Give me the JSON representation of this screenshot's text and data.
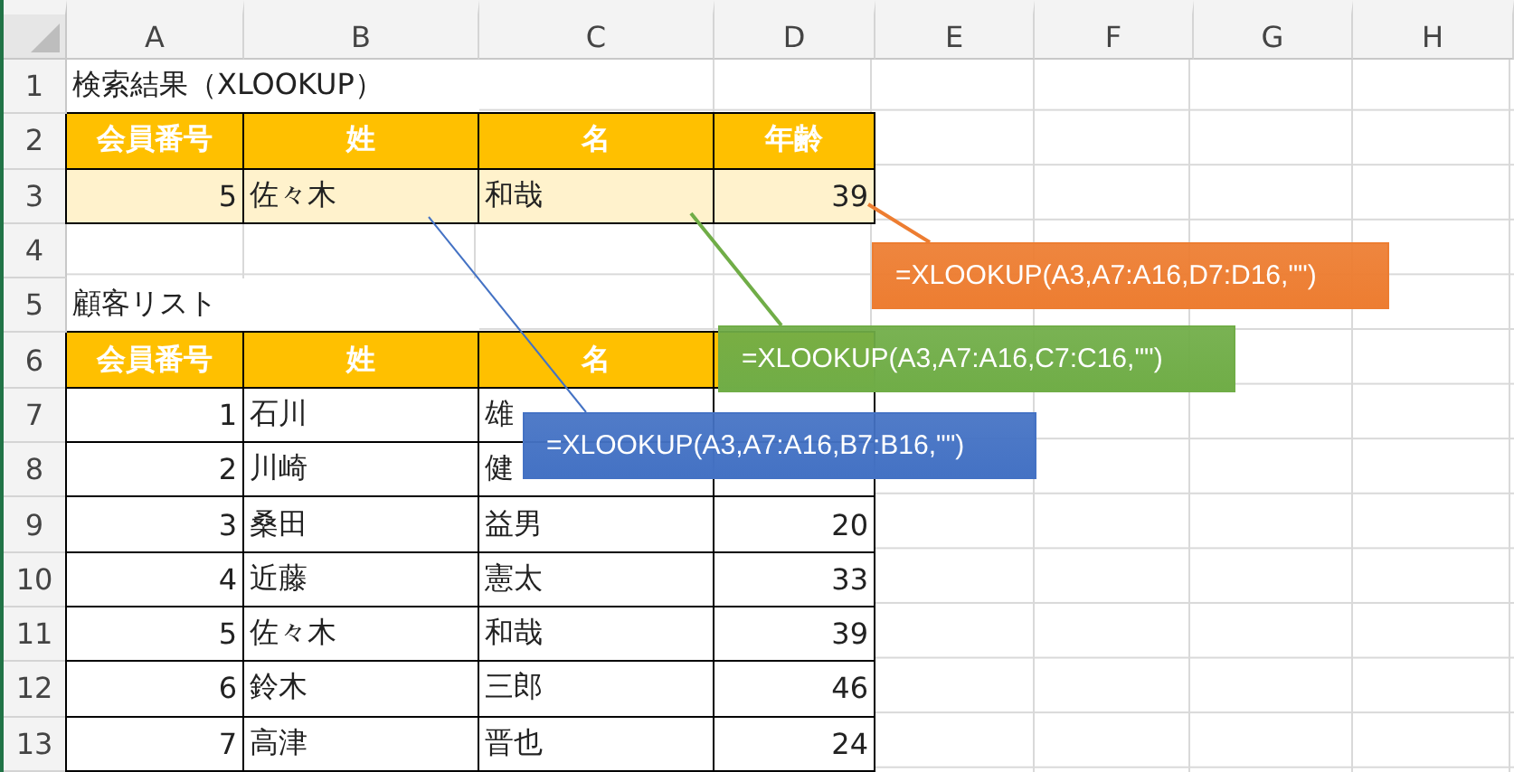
{
  "columns": [
    "A",
    "B",
    "C",
    "D",
    "E",
    "F",
    "G",
    "H"
  ],
  "rows": [
    {
      "number": "1",
      "cells": [
        {
          "text": "検索結果（XLOOKUP）",
          "kind": "label"
        }
      ]
    },
    {
      "number": "2",
      "cells": [
        {
          "text": "会員番号",
          "kind": "header"
        },
        {
          "text": "姓",
          "kind": "header"
        },
        {
          "text": "名",
          "kind": "header"
        },
        {
          "text": "年齢",
          "kind": "header"
        }
      ]
    },
    {
      "number": "3",
      "cells": [
        {
          "text": "5",
          "kind": "result"
        },
        {
          "text": "佐々木",
          "kind": "result"
        },
        {
          "text": "和哉",
          "kind": "result"
        },
        {
          "text": "39",
          "kind": "result"
        }
      ]
    },
    {
      "number": "4",
      "cells": []
    },
    {
      "number": "5",
      "cells": [
        {
          "text": "顧客リスト",
          "kind": "label"
        }
      ]
    },
    {
      "number": "6",
      "cells": [
        {
          "text": "会員番号",
          "kind": "header"
        },
        {
          "text": "姓",
          "kind": "header"
        },
        {
          "text": "名",
          "kind": "header"
        },
        {
          "kind": "header"
        }
      ]
    },
    {
      "number": "7",
      "cells": [
        {
          "text": "1",
          "kind": "data"
        },
        {
          "text": "石川",
          "kind": "data"
        },
        {
          "text": "雄",
          "kind": "data"
        },
        {
          "kind": "data"
        }
      ]
    },
    {
      "number": "8",
      "cells": [
        {
          "text": "2",
          "kind": "data"
        },
        {
          "text": "川崎",
          "kind": "data"
        },
        {
          "text": "健",
          "kind": "data"
        },
        {
          "kind": "data"
        }
      ]
    },
    {
      "number": "9",
      "cells": [
        {
          "text": "3",
          "kind": "data"
        },
        {
          "text": "桑田",
          "kind": "data"
        },
        {
          "text": "益男",
          "kind": "data"
        },
        {
          "text": "20",
          "kind": "data"
        }
      ]
    },
    {
      "number": "10",
      "cells": [
        {
          "text": "4",
          "kind": "data"
        },
        {
          "text": "近藤",
          "kind": "data"
        },
        {
          "text": "憲太",
          "kind": "data"
        },
        {
          "text": "33",
          "kind": "data"
        }
      ]
    },
    {
      "number": "11",
      "cells": [
        {
          "text": "5",
          "kind": "data"
        },
        {
          "text": "佐々木",
          "kind": "data"
        },
        {
          "text": "和哉",
          "kind": "data"
        },
        {
          "text": "39",
          "kind": "data"
        }
      ]
    },
    {
      "number": "12",
      "cells": [
        {
          "text": "6",
          "kind": "data"
        },
        {
          "text": "鈴木",
          "kind": "data"
        },
        {
          "text": "三郎",
          "kind": "data"
        },
        {
          "text": "46",
          "kind": "data"
        }
      ]
    },
    {
      "number": "13",
      "cells": [
        {
          "text": "7",
          "kind": "data"
        },
        {
          "text": "高津",
          "kind": "data"
        },
        {
          "text": "晋也",
          "kind": "data"
        },
        {
          "text": "24",
          "kind": "data"
        }
      ]
    }
  ],
  "callouts": [
    {
      "text": "=XLOOKUP(A3,A7:A16,D7:D16,\"\")",
      "color": "#ed7d31"
    },
    {
      "text": "=XLOOKUP(A3,A7:A16,C7:C16,\"\")",
      "color": "#70ad47"
    },
    {
      "text": "=XLOOKUP(A3,A7:A16,B7:B16,\"\")",
      "color": "#4472c4"
    }
  ]
}
